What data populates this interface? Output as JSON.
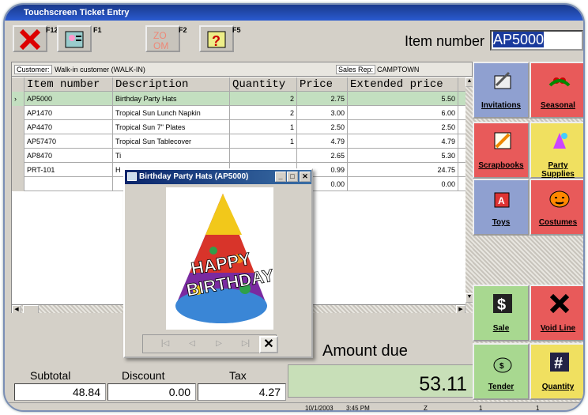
{
  "window_title": "Touchscreen Ticket Entry",
  "toolbar": {
    "buttons": [
      {
        "key": "F12",
        "icon": "cancel-x-icon"
      },
      {
        "key": "F1",
        "icon": "contacts-card-icon"
      },
      {
        "key": "F2",
        "icon": "zoom-icon"
      },
      {
        "key": "F5",
        "icon": "help-icon"
      }
    ],
    "item_number_label": "Item number",
    "item_number_value": "AP5000"
  },
  "customer": {
    "label": "Customer:",
    "value": "Walk-in customer  (WALK-IN)"
  },
  "sales_rep": {
    "label": "Sales Rep:",
    "value": "CAMPTOWN"
  },
  "grid": {
    "columns": [
      "Item number",
      "Description",
      "Quantity",
      "Price",
      "Extended price"
    ],
    "rows": [
      {
        "item": "AP5000",
        "desc": "Birthday Party Hats",
        "qty": "2",
        "price": "2.75",
        "ext": "5.50",
        "selected": true
      },
      {
        "item": "AP1470",
        "desc": "Tropical Sun Lunch Napkin",
        "qty": "2",
        "price": "3.00",
        "ext": "6.00"
      },
      {
        "item": "AP4470",
        "desc": "Tropical Sun 7\" Plates",
        "qty": "1",
        "price": "2.50",
        "ext": "2.50"
      },
      {
        "item": "AP57470",
        "desc": "Tropical Sun Tablecover",
        "qty": "1",
        "price": "4.79",
        "ext": "4.79"
      },
      {
        "item": "AP8470",
        "desc": "Ti",
        "qty": "",
        "price": "2.65",
        "ext": "5.30"
      },
      {
        "item": "PRT-101",
        "desc": "H",
        "qty": "",
        "price": "0.99",
        "ext": "24.75"
      },
      {
        "item": "",
        "desc": "",
        "qty": "",
        "price": "0.00",
        "ext": "0.00"
      }
    ]
  },
  "popup": {
    "title": "Birthday Party Hats (AP5000)",
    "image_text": [
      "HAPPY",
      "BIRTHDAY"
    ]
  },
  "totals": {
    "subtotal_label": "Subtotal",
    "subtotal": "48.84",
    "discount_label": "Discount",
    "discount": "0.00",
    "tax_label": "Tax",
    "tax": "4.27",
    "amount_due_label": "Amount due",
    "amount_due": "53.11"
  },
  "status": {
    "date": "10/1/2003",
    "time": "3:45 PM",
    "c3": "Z",
    "c4": "1",
    "c5": "1"
  },
  "categories": [
    {
      "label": "Invitations",
      "color": "#8fa0d0",
      "icon": "invitation-icon"
    },
    {
      "label": "Seasonal",
      "color": "#e85a5a",
      "icon": "holly-icon"
    },
    {
      "label": "Scrapbooks",
      "color": "#e85a5a",
      "icon": "scrapbook-pencil-icon"
    },
    {
      "label": "Party Supplies",
      "color": "#f0e060",
      "icon": "party-supplies-icon"
    },
    {
      "label": "Toys",
      "color": "#8fa0d0",
      "icon": "toy-blocks-icon"
    },
    {
      "label": "Costumes",
      "color": "#e85a5a",
      "icon": "pumpkin-icon"
    },
    {
      "label": "Sale",
      "color": "#a8d890",
      "icon": "dollar-sale-icon"
    },
    {
      "label": "Void Line",
      "color": "#e85a5a",
      "icon": "void-x-icon"
    },
    {
      "label": "Tender",
      "color": "#a8d890",
      "icon": "money-bag-icon"
    },
    {
      "label": "Quantity",
      "color": "#f0e060",
      "icon": "hash-icon"
    }
  ]
}
